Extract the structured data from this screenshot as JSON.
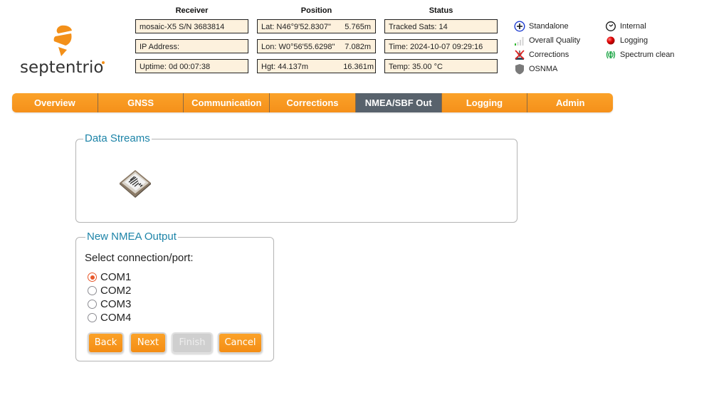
{
  "brand": {
    "name": "septentrio",
    "accent": "#f39019"
  },
  "header": {
    "receiver": {
      "title": "Receiver",
      "model": "mosaic-X5 S/N 3683814",
      "ip": "IP Address:",
      "uptime": "Uptime: 0d 00:07:38"
    },
    "position": {
      "title": "Position",
      "lat_label": "Lat:  N46°9'52.8307\"",
      "lat_err": "5.765m",
      "lon_label": "Lon: W0°56'55.6298\"",
      "lon_err": "7.082m",
      "hgt_label": "Hgt:  44.137m",
      "hgt_err": "16.361m"
    },
    "status": {
      "title": "Status",
      "tracked": "Tracked Sats: 14",
      "time": "Time: 2024-10-07 09:29:16",
      "temp": "Temp: 35.00 °C"
    },
    "legend": [
      {
        "icon": "crosshair-icon",
        "label": "Standalone"
      },
      {
        "icon": "signal-bars-icon",
        "label": "Overall Quality"
      },
      {
        "icon": "corrections-off-icon",
        "label": "Corrections"
      },
      {
        "icon": "shield-icon",
        "label": "OSNMA"
      },
      {
        "icon": "clock-icon",
        "label": "Internal"
      },
      {
        "icon": "red-dot-icon",
        "label": "Logging"
      },
      {
        "icon": "spectrum-icon",
        "label": "Spectrum clean"
      }
    ]
  },
  "nav": {
    "tabs": [
      {
        "label": "Overview"
      },
      {
        "label": "GNSS"
      },
      {
        "label": "Communication"
      },
      {
        "label": "Corrections"
      },
      {
        "label": "NMEA/SBF Out",
        "active": true
      },
      {
        "label": "Logging"
      },
      {
        "label": "Admin"
      }
    ]
  },
  "data_streams": {
    "title": "Data Streams",
    "chip_icon": "receiver-module-icon"
  },
  "new_output": {
    "title": "New NMEA Output",
    "prompt": "Select connection/port:",
    "options": [
      {
        "label": "COM1",
        "checked": true
      },
      {
        "label": "COM2",
        "checked": false
      },
      {
        "label": "COM3",
        "checked": false
      },
      {
        "label": "COM4",
        "checked": false
      }
    ],
    "buttons": {
      "back": "Back",
      "next": "Next",
      "finish": "Finish",
      "cancel": "Cancel"
    },
    "finish_disabled": true
  }
}
